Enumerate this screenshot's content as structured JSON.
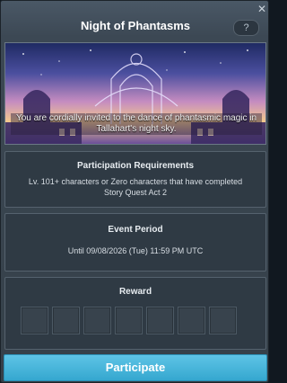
{
  "window": {
    "title": "Night of Phantasms",
    "close_glyph": "✕",
    "help_label": "?"
  },
  "banner": {
    "text": "You are cordially invited to the dance of phantasmic magic in Tallahart's night sky.",
    "image_icon": "palace-night-sky-illustration"
  },
  "requirements": {
    "heading": "Participation Requirements",
    "line1": "Lv. 101+ characters or Zero characters that have completed",
    "line2": "Story Quest Act 2"
  },
  "event_period": {
    "heading": "Event Period",
    "text": "Until 09/08/2026 (Tue) 11:59 PM UTC"
  },
  "reward": {
    "heading": "Reward",
    "slot_count": 7
  },
  "action": {
    "participate_label": "Participate"
  },
  "colors": {
    "accent": "#3fb4db",
    "panel": "#2f3a44",
    "window": "#3c4854"
  }
}
